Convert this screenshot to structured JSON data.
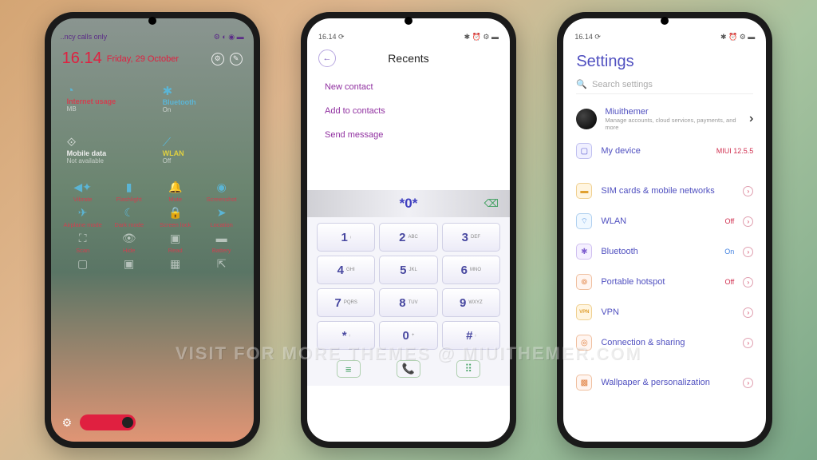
{
  "watermark": "VISIT FOR MORE THEMES @ MIUITHEMER.COM",
  "p1": {
    "status_left": "..ncy calls only",
    "status_right": "⚙ ◐ ◉ ▬",
    "time": "16.14",
    "date": "Friday, 29 October",
    "big": [
      {
        "icon": "◔",
        "label": "Internet usage",
        "sub": "MB"
      },
      {
        "icon": "✱",
        "label": "Bluetooth",
        "sub": "On"
      },
      {
        "icon": "⟐",
        "label": "Mobile data",
        "sub": "Not available"
      },
      {
        "icon": "⟋",
        "label": "WLAN",
        "sub": "Off"
      }
    ],
    "tiles": [
      {
        "icon": "◀✦",
        "label": "Vibrate"
      },
      {
        "icon": "▮",
        "label": "Flashlight"
      },
      {
        "icon": "🔔",
        "label": "Mute"
      },
      {
        "icon": "◉",
        "label": "Screenshot"
      },
      {
        "icon": "✈",
        "label": "Airplane mode"
      },
      {
        "icon": "☾",
        "label": "Dark mode"
      },
      {
        "icon": "🔒",
        "label": "Screen lock"
      },
      {
        "icon": "➤",
        "label": "Location"
      },
      {
        "icon": "⛶",
        "label": "Scan"
      },
      {
        "icon": "👁",
        "label": "Hide"
      },
      {
        "icon": "▣",
        "label": "Read"
      },
      {
        "icon": "▬",
        "label": "Battery"
      },
      {
        "icon": "▢",
        "label": ""
      },
      {
        "icon": "▣",
        "label": ""
      },
      {
        "icon": "▦",
        "label": ""
      },
      {
        "icon": "⇱",
        "label": ""
      }
    ]
  },
  "p2": {
    "time": "16.14 ⟳",
    "icons": "✱ ⏰ ⚙ ▬",
    "title": "Recents",
    "menu": [
      "New contact",
      "Add to contacts",
      "Send message"
    ],
    "number": "*0*",
    "keys": [
      {
        "n": "1",
        "l": "ᵢ"
      },
      {
        "n": "2",
        "l": "ABC"
      },
      {
        "n": "3",
        "l": "DEF"
      },
      {
        "n": "4",
        "l": "GHI"
      },
      {
        "n": "5",
        "l": "JKL"
      },
      {
        "n": "6",
        "l": "MNO"
      },
      {
        "n": "7",
        "l": "PQRS"
      },
      {
        "n": "8",
        "l": "TUV"
      },
      {
        "n": "9",
        "l": "WXYZ"
      },
      {
        "n": "*",
        "l": "ᵢ"
      },
      {
        "n": "0",
        "l": "+"
      },
      {
        "n": "#",
        "l": "ᵢ"
      }
    ]
  },
  "p3": {
    "time": "16.14 ⟳",
    "icons": "✱ ⏰ ⚙ ▬",
    "title": "Settings",
    "search": "Search settings",
    "account": {
      "name": "Miuithemer",
      "desc": "Manage accounts, cloud services, payments, and more"
    },
    "mydevice": {
      "label": "My device",
      "status": "MIUI 12.5.5"
    },
    "rows": [
      {
        "icon": "▬",
        "cls": "i-sim",
        "label": "SIM cards & mobile networks",
        "status": ""
      },
      {
        "icon": "⌔",
        "cls": "i-wlan",
        "label": "WLAN",
        "status": "Off"
      },
      {
        "icon": "✱",
        "cls": "i-bt",
        "label": "Bluetooth",
        "status": "On"
      },
      {
        "icon": "⊚",
        "cls": "i-hs",
        "label": "Portable hotspot",
        "status": "Off"
      },
      {
        "icon": "VPN",
        "cls": "i-vpn",
        "label": "VPN",
        "status": ""
      },
      {
        "icon": "◎",
        "cls": "i-cs",
        "label": "Connection & sharing",
        "status": ""
      }
    ],
    "wallpaper": {
      "icon": "▩",
      "label": "Wallpaper & personalization"
    }
  }
}
